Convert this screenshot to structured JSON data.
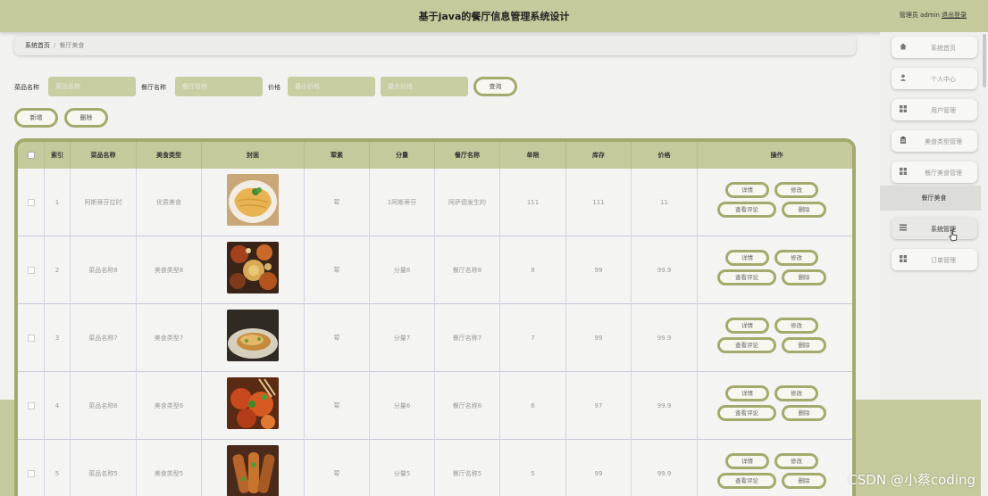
{
  "header": {
    "title": "基于java的餐厅信息管理系统设计",
    "user": "管理员 admin",
    "logout": "退出登录"
  },
  "breadcrumb": {
    "home": "系统首页",
    "current": "餐厅美食"
  },
  "search": {
    "dish_label": "菜品名称",
    "dish_placeholder": "菜品名称",
    "restaurant_label": "餐厅名称",
    "restaurant_placeholder": "餐厅名称",
    "price_label": "价格",
    "min_placeholder": "最小价格",
    "max_placeholder": "最大价格",
    "query_button": "查询"
  },
  "toolbar": {
    "add": "新增",
    "delete": "删除"
  },
  "table": {
    "headers": [
      "索引",
      "菜品名称",
      "美食类型",
      "封面",
      "荤素",
      "分量",
      "餐厅名称",
      "单限",
      "库存",
      "价格",
      "操作"
    ],
    "rows": [
      {
        "index": "1",
        "name": "阿斯蒂芬拉时",
        "type": "优质美食",
        "meat": "荤",
        "portion": "1阿斯蒂芬",
        "restaurant": "阿萨德发生的",
        "limit": "111",
        "stock": "111",
        "price": "11"
      },
      {
        "index": "2",
        "name": "菜品名称8",
        "type": "美食类型8",
        "meat": "荤",
        "portion": "分量8",
        "restaurant": "餐厅名称8",
        "limit": "8",
        "stock": "99",
        "price": "99.9"
      },
      {
        "index": "3",
        "name": "菜品名称7",
        "type": "美食类型7",
        "meat": "荤",
        "portion": "分量7",
        "restaurant": "餐厅名称7",
        "limit": "7",
        "stock": "99",
        "price": "99.9"
      },
      {
        "index": "4",
        "name": "菜品名称6",
        "type": "美食类型6",
        "meat": "荤",
        "portion": "分量6",
        "restaurant": "餐厅名称6",
        "limit": "6",
        "stock": "97",
        "price": "99.9"
      },
      {
        "index": "5",
        "name": "菜品名称5",
        "type": "美食类型5",
        "meat": "荤",
        "portion": "分量5",
        "restaurant": "餐厅名称5",
        "limit": "5",
        "stock": "99",
        "price": "99.9"
      }
    ],
    "actions": {
      "detail": "详情",
      "edit": "修改",
      "comments": "查看评论",
      "delete": "删除"
    }
  },
  "sidebar": {
    "items": [
      {
        "label": "系统首页",
        "icon": "home-icon"
      },
      {
        "label": "个人中心",
        "icon": "user-icon"
      },
      {
        "label": "用户管理",
        "icon": "grid-icon"
      },
      {
        "label": "美食类型管理",
        "icon": "clipboard-icon"
      },
      {
        "label": "餐厅美食管理",
        "icon": "grid-icon"
      },
      {
        "label": "系统管理",
        "icon": "list-icon"
      },
      {
        "label": "订单管理",
        "icon": "grid-icon"
      }
    ],
    "sub_item": "餐厅美食"
  },
  "watermark": "CSDN @小蔡coding"
}
